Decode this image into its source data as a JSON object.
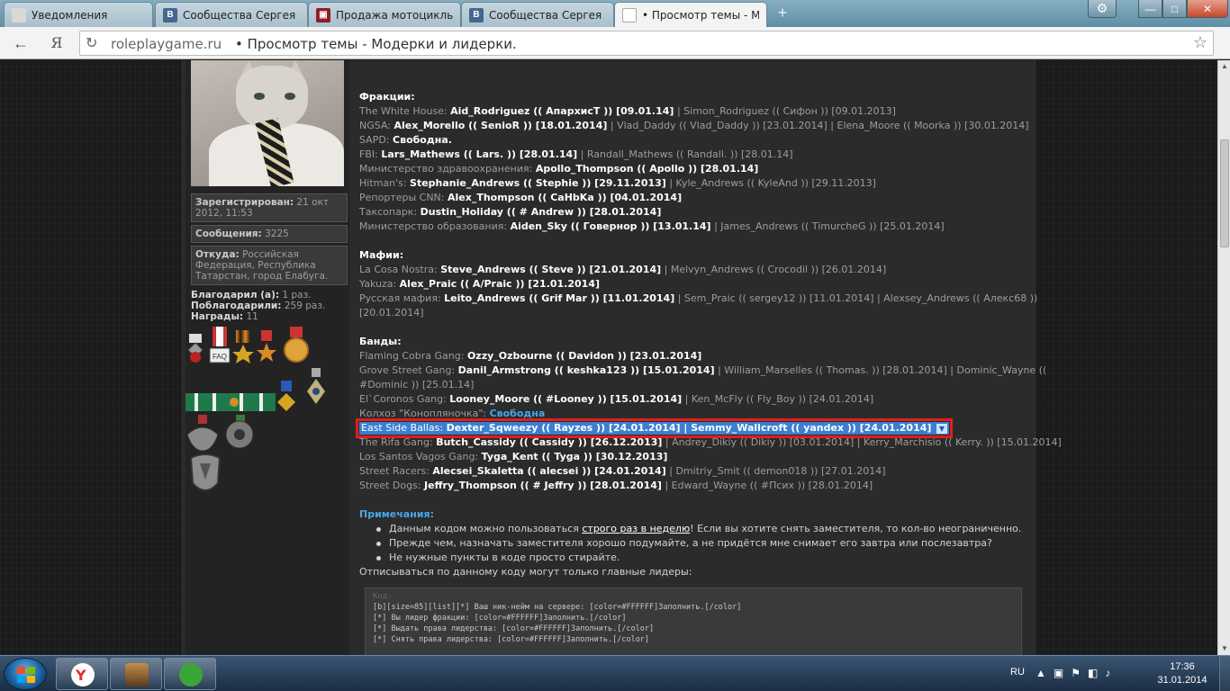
{
  "browser": {
    "tabs": [
      {
        "title": "Уведомления",
        "icon": "notification-favicon",
        "color": "#d9d9d9"
      },
      {
        "title": "Сообщества Сергея К",
        "icon": "vk-favicon",
        "color": "#45668e"
      },
      {
        "title": "Продажа мотоциклы",
        "icon": "motorcycle-site-favicon",
        "color": "#8e1d2a"
      },
      {
        "title": "Сообщества Сергея К",
        "icon": "vk-favicon",
        "color": "#45668e"
      },
      {
        "title": "• Просмотр темы - М",
        "icon": "page-favicon",
        "color": "#ffffff",
        "active": true
      }
    ],
    "new_tab_glyph": "+",
    "address": {
      "host": "roleplaygame.ru",
      "separator": "•",
      "title": "Просмотр темы - Модерки и лидерки."
    },
    "back_glyph": "←",
    "yandex_glyph": "Я",
    "reload_glyph": "↻",
    "bookmark_glyph": "☆",
    "settings_glyph": "⚙",
    "minimize_glyph": "—",
    "maximize_glyph": "□",
    "close_glyph": "✕"
  },
  "user": {
    "registered_label": "Зарегистрирован:",
    "registered_value": "21 окт 2012, 11:53",
    "messages_label": "Сообщения:",
    "messages_value": "3225",
    "from_label": "Откуда:",
    "from_value": "Российская Федерация, Республика Татарстан, город Елабуга.",
    "thanked_label": "Благодарил (а):",
    "thanked_value": "1 раз.",
    "got_thanks_label": "Поблагодарили:",
    "got_thanks_value": "259 раз.",
    "awards_label": "Награды:",
    "awards_value": "11",
    "faq_badge": "FAQ"
  },
  "post": {
    "factions_title": "Фракции:",
    "factions": [
      {
        "name": "The White House:",
        "parts": [
          {
            "b": "Aid_Rodriguez (( АпархисТ )) [09.01.14]"
          },
          {
            "t": " | Simon_Rodriguez (( Сифон )) [09.01.2013]"
          }
        ]
      },
      {
        "name": "NGSA:",
        "parts": [
          {
            "b": "Alex_Morello (( SenioR )) [18.01.2014]"
          },
          {
            "t": " | Vlad_Daddy (( Vlad_Daddy )) [23.01.2014] | Elena_Moore (( Moorka )) [30.01.2014]"
          }
        ]
      },
      {
        "name": "SAPD:",
        "parts": [
          {
            "b": "Свободна."
          }
        ]
      },
      {
        "name": "FBI:",
        "parts": [
          {
            "b": "Lars_Mathews (( Lars. )) [28.01.14]"
          },
          {
            "t": " | Randall_Mathews (( Randall. )) [28.01.14]"
          }
        ]
      },
      {
        "name": "Министерство здравоохранения:",
        "parts": [
          {
            "b": "Apollo_Thompson (( Apollo )) [28.01.14]"
          }
        ]
      },
      {
        "name": "Hitman's:",
        "parts": [
          {
            "b": "Stephanie_Andrews (( Stephie )) [29.11.2013]"
          },
          {
            "t": " | Kyle_Andrews (( KyleAnd )) [29.11.2013]"
          }
        ]
      },
      {
        "name": "Репортеры CNN:",
        "parts": [
          {
            "b": "Alex_Thompson (( CaHbKa )) [04.01.2014]"
          }
        ]
      },
      {
        "name": "Таксопарк:",
        "parts": [
          {
            "b": "Dustin_Holiday (( # Andrew )) [28.01.2014]"
          }
        ]
      },
      {
        "name": "Министерство образования:",
        "parts": [
          {
            "b": "Aiden_Sky (( Говернор )) [13.01.14]"
          },
          {
            "t": " | James_Andrews (( TimurcheG )) [25.01.2014]"
          }
        ]
      }
    ],
    "mafia_title": "Мафии:",
    "mafias": [
      {
        "name": "La Cosa Nostra:",
        "parts": [
          {
            "b": "Steve_Andrews (( Steve )) [21.01.2014]"
          },
          {
            "t": " | Melvyn_Andrews (( Crocodil )) [26.01.2014]"
          }
        ]
      },
      {
        "name": "Yakuza:",
        "parts": [
          {
            "b": "Alex_Praic (( A/Praic )) [21.01.2014]"
          }
        ]
      },
      {
        "name": "Русская мафия:",
        "parts": [
          {
            "b": "Leito_Andrews (( Grif Mar )) [11.01.2014]"
          },
          {
            "t": " | Sem_Praic (( sergey12 )) [11.01.2014] | Alexsey_Andrews (( Алекс68 ))"
          }
        ]
      },
      {
        "name": "",
        "parts": [
          {
            "t": "[20.01.2014]"
          }
        ]
      }
    ],
    "gangs_title": "Банды:",
    "gangs": [
      {
        "name": "Flaming Cobra Gang:",
        "parts": [
          {
            "b": "Ozzy_Ozbourne (( Davidon )) [23.01.2014]"
          }
        ]
      },
      {
        "name": "Grove Street Gang:",
        "parts": [
          {
            "b": "Danil_Armstrong (( keshka123 )) [15.01.2014]"
          },
          {
            "t": " | William_Marselles (( Thomas. )) [28.01.2014] | Dominic_Wayne (("
          }
        ]
      },
      {
        "name": "",
        "parts": [
          {
            "t": "#Dominic )) [25.01.14]"
          }
        ]
      },
      {
        "name": "El`Coronos Gang:",
        "parts": [
          {
            "b": "Looney_Moore (( #Looney )) [15.01.2014]"
          },
          {
            "t": " | Ken_McFly (( Fly_Boy )) [24.01.2014]"
          }
        ]
      },
      {
        "name": "Колхоз \"Конопляночка\":",
        "link": "Свободна"
      }
    ],
    "highlight": {
      "name": "East Side Ballas:",
      "text": "Dexter_Sqweezy (( Rayzes )) [24.01.2014] | Semmy_Wallcroft (( yandex )) [24.01.2014]",
      "arrow": "▼"
    },
    "gangs2": [
      {
        "name": "The Rifa Gang:",
        "parts": [
          {
            "b": "Butch_Cassidy (( Cassidy )) [26.12.2013]"
          },
          {
            "t": " | Andrey_Dikiy (( Dikiy )) [03.01.2014] | Kerry_Marchisio (( Kerry. )) [15.01.2014]"
          }
        ]
      },
      {
        "name": "Los Santos Vagos Gang:",
        "parts": [
          {
            "b": "Tyga_Kent (( Tyga )) [30.12.2013]"
          }
        ]
      },
      {
        "name": "Street Racers:",
        "parts": [
          {
            "b": "Alecsei_Skaletta (( alecsei )) [24.01.2014]"
          },
          {
            "t": " | Dmitriy_Smit (( demon018 )) [27.01.2014]"
          }
        ]
      },
      {
        "name": "Street Dogs:",
        "parts": [
          {
            "b": "Jeffry_Thompson (( # Jeffry )) [28.01.2014]"
          },
          {
            "t": " | Edward_Wayne (( #Псих )) [28.01.2014]"
          }
        ]
      }
    ],
    "notes_title": "Примечания:",
    "note1_a": "Данным кодом можно пользоваться ",
    "note1_u": "строго раз в неделю",
    "note1_b": "! Если вы хотите снять заместителя, то кол-во неограниченно.",
    "note2": "Прежде чем, назначать заместителя хорошо подумайте, а не придётся мне снимает его завтра или послезавтра?",
    "note3": "Не нужные пункты в коде просто стирайте.",
    "tail": "Отписываться по данному коду могут только главные лидеры:",
    "code_label": "Код:",
    "code_lines": [
      "[b][size=85][list][*] Ваш ник-нейм на сервере: [color=#FFFFFF]Заполнить.[/color]",
      "[*] Вы лидер фракции: [color=#FFFFFF]Заполнить.[/color]",
      "[*] Выдать права лидерства: [color=#FFFFFF]Заполнить.[/color]",
      "[*] Снять права лидерства: [color=#FFFFFF]Заполнить.[/color]"
    ]
  },
  "taskbar": {
    "lang": "RU",
    "time": "17:36",
    "date": "31.01.2014",
    "apps": [
      {
        "name": "yandex-browser-icon",
        "color": "#e82c2c"
      },
      {
        "name": "game-app-icon",
        "color": "#8a6a3a"
      },
      {
        "name": "qip-messenger-icon",
        "color": "#3aa63a"
      }
    ],
    "tray": [
      "▲",
      "▣",
      "⚑",
      "◧",
      "♪"
    ]
  }
}
